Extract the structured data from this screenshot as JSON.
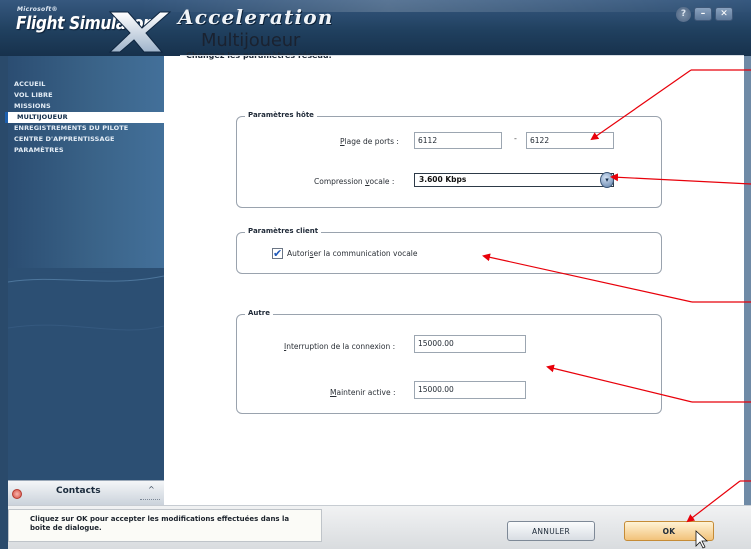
{
  "titlebar": {
    "microsoft": "Microsoft®",
    "product": "Flight Simulator",
    "edition": "Acceleration",
    "help_icon": "question-icon",
    "minimize_symbol": "–",
    "close_symbol": "✕"
  },
  "sidebar": {
    "items": [
      {
        "label": "ACCUEIL",
        "active": false
      },
      {
        "label": "VOL LIBRE",
        "active": false
      },
      {
        "label": "MISSIONS",
        "active": false
      },
      {
        "label": "MULTIJOUEUR",
        "active": true
      },
      {
        "label": "ENREGISTREMENTS DU PILOTE",
        "active": false
      },
      {
        "label": "CENTRE D'APPRENTISSAGE",
        "active": false
      },
      {
        "label": "PARAMÈTRES",
        "active": false
      }
    ],
    "contacts": {
      "label": "Contacts",
      "chevron": "^"
    }
  },
  "main": {
    "title": "Multijoueur",
    "subtitle": "Changez les paramètres réseau.",
    "host": {
      "legend": "Paramètres hôte",
      "ports_label_pre": "",
      "ports_label_u": "P",
      "ports_label_post": "lage de ports :",
      "port_from": "6112",
      "port_dash": "-",
      "port_to": "6122",
      "voice_label_pre": "Compression ",
      "voice_label_u": "v",
      "voice_label_post": "ocale :",
      "voice_value": "3.600 Kbps",
      "voice_arrow": "▾"
    },
    "client": {
      "legend": "Paramètres client",
      "voice_chk_pre": "Autori",
      "voice_chk_u": "s",
      "voice_chk_post": "er la communication vocale",
      "voice_checked": true,
      "check_mark": "✔"
    },
    "other": {
      "legend": "Autre",
      "timeout_label_pre": "",
      "timeout_label_u": "I",
      "timeout_label_post": "nterruption de la connexion :",
      "timeout_value": "15000.00",
      "keepalive_label_pre": "",
      "keepalive_label_u": "M",
      "keepalive_label_post": "aintenir active :",
      "keepalive_value": "15000.00"
    }
  },
  "footer": {
    "hint_line1": "Cliquez sur OK pour accepter les modifications effectuées dans la",
    "hint_line2": "boîte de dialogue.",
    "cancel_label": "ANNULER",
    "ok_label": "OK"
  },
  "colors": {
    "annotation_arrow": "#e8000a",
    "sidebar": "#3a6388",
    "active_accent": "#1c5fae"
  }
}
